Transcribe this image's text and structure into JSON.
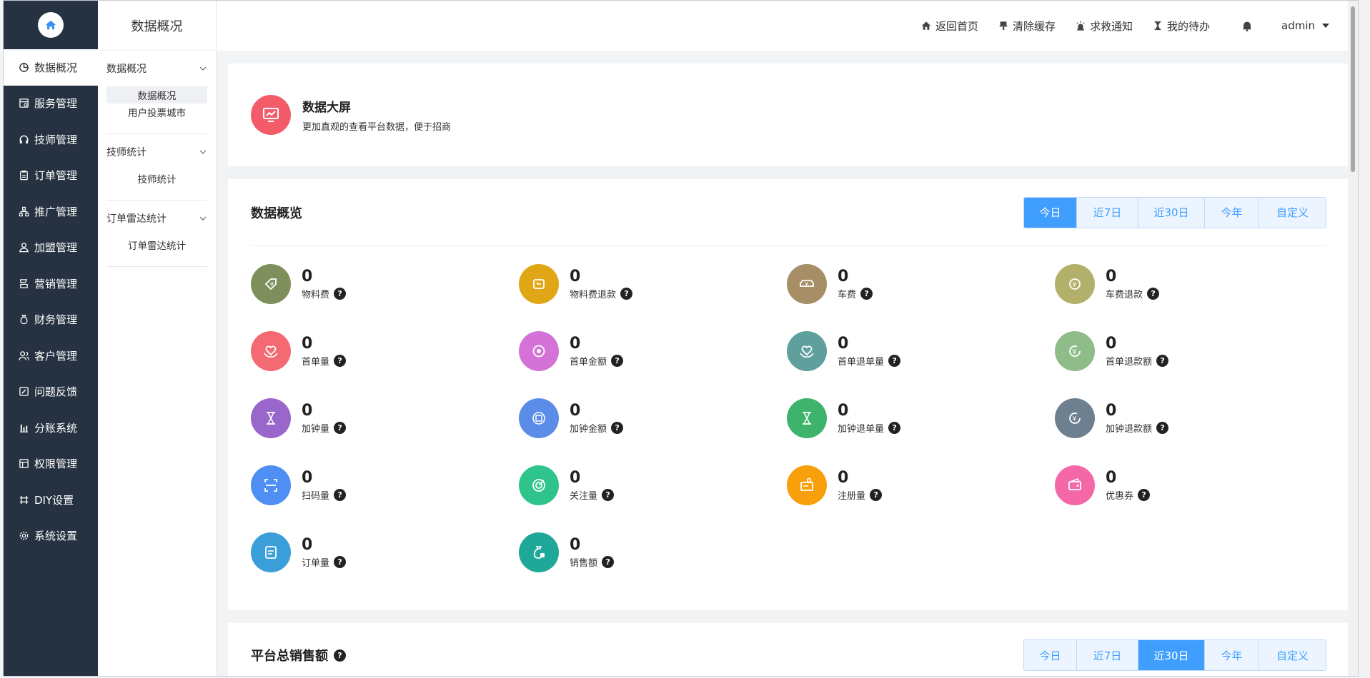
{
  "sidebar": {
    "items": [
      {
        "label": "数据概况",
        "icon": "pie-chart-icon"
      },
      {
        "label": "服务管理",
        "icon": "service-icon"
      },
      {
        "label": "技师管理",
        "icon": "headset-icon"
      },
      {
        "label": "订单管理",
        "icon": "clipboard-icon"
      },
      {
        "label": "推广管理",
        "icon": "network-icon"
      },
      {
        "label": "加盟管理",
        "icon": "users-icon"
      },
      {
        "label": "营销管理",
        "icon": "marketing-icon"
      },
      {
        "label": "财务管理",
        "icon": "money-bag-icon"
      },
      {
        "label": "客户管理",
        "icon": "customer-icon"
      },
      {
        "label": "问题反馈",
        "icon": "feedback-icon"
      },
      {
        "label": "分账系统",
        "icon": "bar-chart-icon"
      },
      {
        "label": "权限管理",
        "icon": "permission-icon"
      },
      {
        "label": "DIY设置",
        "icon": "diy-icon"
      },
      {
        "label": "系统设置",
        "icon": "gear-icon"
      }
    ]
  },
  "subbar": {
    "title": "数据概况",
    "groups": [
      {
        "title": "数据概况",
        "links": [
          "数据概况",
          "用户投票城市"
        ]
      },
      {
        "title": "技师统计",
        "links": [
          "技师统计"
        ]
      },
      {
        "title": "订单雷达统计",
        "links": [
          "订单雷达统计"
        ]
      }
    ]
  },
  "header": {
    "home": "返回首页",
    "clear_cache": "清除缓存",
    "sos": "求救通知",
    "todo": "我的待办",
    "user": "admin"
  },
  "banner": {
    "title": "数据大屏",
    "subtitle": "更加直观的查看平台数据，便于招商"
  },
  "overview": {
    "title": "数据概览",
    "tabs": [
      "今日",
      "近7日",
      "近30日",
      "今年",
      "自定义"
    ],
    "active_tab": "今日",
    "stats": [
      {
        "value": "0",
        "label": "物料费",
        "color": "#7e8f5c",
        "icon": "tag-yen-icon"
      },
      {
        "value": "0",
        "label": "物料费退款",
        "color": "#e0a616",
        "icon": "box-refund-icon"
      },
      {
        "value": "0",
        "label": "车费",
        "color": "#a88e66",
        "icon": "car-yen-icon"
      },
      {
        "value": "0",
        "label": "车费退款",
        "color": "#b2b06a",
        "icon": "yen-refund-icon"
      },
      {
        "value": "0",
        "label": "首单量",
        "color": "#f46a72",
        "icon": "heart-hand-icon"
      },
      {
        "value": "0",
        "label": "首单金额",
        "color": "#d472d8",
        "icon": "coin-bag-icon"
      },
      {
        "value": "0",
        "label": "首单退单量",
        "color": "#5f9f9c",
        "icon": "heart-hand-icon"
      },
      {
        "value": "0",
        "label": "首单退款额",
        "color": "#8fbd8a",
        "icon": "yen-refresh-icon"
      },
      {
        "value": "0",
        "label": "加钟量",
        "color": "#9966cc",
        "icon": "hourglass-icon"
      },
      {
        "value": "0",
        "label": "加钟金额",
        "color": "#5b8ce8",
        "icon": "money-cycle-icon"
      },
      {
        "value": "0",
        "label": "加钟退单量",
        "color": "#3db36b",
        "icon": "hourglass-icon"
      },
      {
        "value": "0",
        "label": "加钟退款额",
        "color": "#6e7f8f",
        "icon": "yen-refresh-icon"
      },
      {
        "value": "0",
        "label": "扫码量",
        "color": "#4f8ef2",
        "icon": "scan-icon"
      },
      {
        "value": "0",
        "label": "关注量",
        "color": "#2ec48c",
        "icon": "target-icon"
      },
      {
        "value": "0",
        "label": "注册量",
        "color": "#f7a00c",
        "icon": "register-icon"
      },
      {
        "value": "0",
        "label": "优惠券",
        "color": "#f468a8",
        "icon": "coupon-icon"
      },
      {
        "value": "0",
        "label": "订单量",
        "color": "#3a9fd8",
        "icon": "order-icon"
      },
      {
        "value": "0",
        "label": "销售额",
        "color": "#1fa898",
        "icon": "sales-bag-icon"
      }
    ]
  },
  "sales": {
    "title": "平台总销售额",
    "tabs": [
      "今日",
      "近7日",
      "近30日",
      "今年",
      "自定义"
    ],
    "active_tab": "近30日"
  }
}
